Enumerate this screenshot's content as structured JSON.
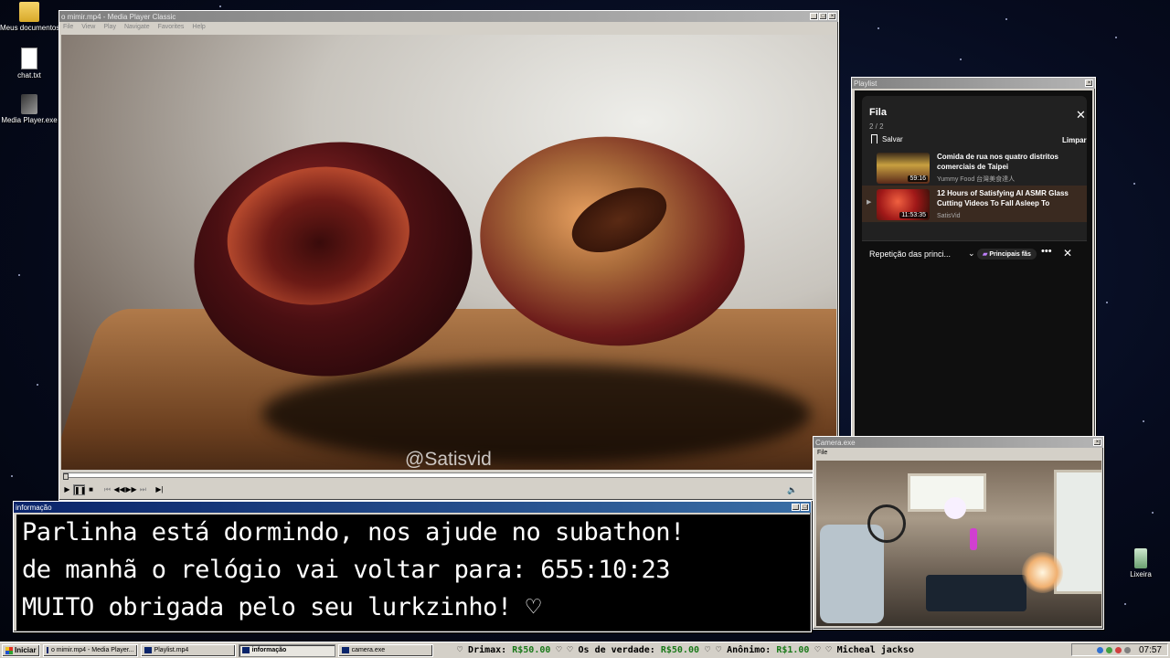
{
  "desktop": {
    "icons": [
      {
        "label": "Meus documentos"
      },
      {
        "label": "chat.txt"
      },
      {
        "label": "Media Player.exe"
      },
      {
        "label": "Lixeira"
      }
    ]
  },
  "player": {
    "title": "o mimir.mp4 - Media Player Classic",
    "menu": [
      "File",
      "View",
      "Play",
      "Navigate",
      "Favorites",
      "Help"
    ],
    "watermark": "@Satisvid",
    "progress": 0.0
  },
  "playlist": {
    "window_title": "Playlist",
    "heading": "Fila",
    "count": "2 / 2",
    "save_label": "Salvar",
    "clear_label": "Limpar",
    "items": [
      {
        "title": "Comida de rua nos quatro distritos comerciais de Taipei",
        "channel": "Yummy Food 台灣美食達人",
        "duration": "59:16",
        "selected": false
      },
      {
        "title": "12 Hours of Satisfying AI ASMR Glass Cutting Videos To Fall Asleep To",
        "channel": "SatisVid",
        "duration": "11:53:35",
        "selected": true
      }
    ],
    "footer": {
      "repeat_label": "Repetição das princi...",
      "fans_label": "Principais fãs"
    }
  },
  "info": {
    "window_title": "informação",
    "lines": [
      "Parlinha está dormindo, nos ajude no subathon!",
      "de manhã o relógio vai voltar para:  655:10:23",
      "MUITO obrigada pelo seu lurkzinho! ♡"
    ]
  },
  "camera": {
    "window_title": "Camera.exe",
    "menu": [
      "File"
    ]
  },
  "taskbar": {
    "start_label": "Iniciar",
    "tasks": [
      {
        "label": "o mimir.mp4 - Media Player...",
        "active": false
      },
      {
        "label": "Playlist.mp4",
        "active": false
      },
      {
        "label": "informação",
        "active": true
      },
      {
        "label": "camera.exe",
        "active": false
      }
    ],
    "ticker": [
      {
        "name": "Drimax:",
        "amount": "R$50.00"
      },
      {
        "name": "Os de verdade:",
        "amount": "R$50.00"
      },
      {
        "name": "Anônimo:",
        "amount": "R$1.00"
      },
      {
        "name": "Micheal jackso",
        "amount": ""
      }
    ],
    "clock": "07:57"
  }
}
